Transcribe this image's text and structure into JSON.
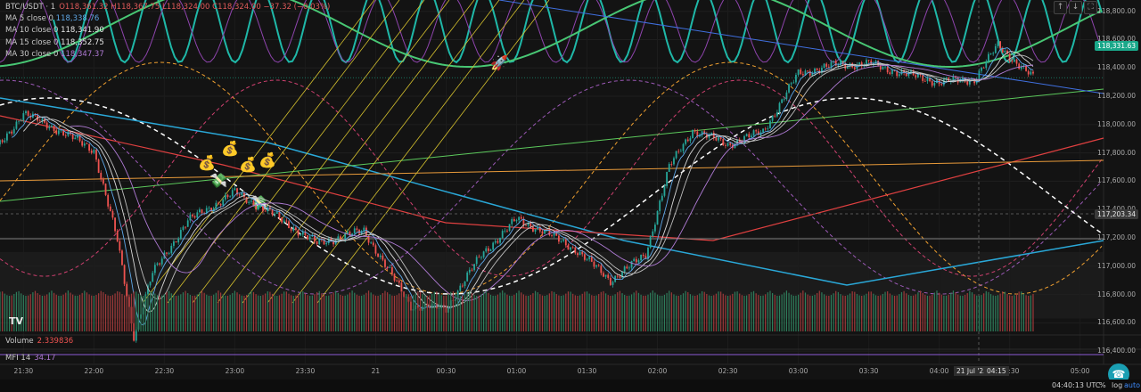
{
  "header": {
    "symbol": "BTC/USDT · 1",
    "ohlc": "O118,361.32 H118,367.75 L118,324.00 C118,324.00 −37.32 (−0.03%)"
  },
  "legend": [
    {
      "label": "MA 5 close 0",
      "value": "118,338.76",
      "color": "#5fa8e8"
    },
    {
      "label": "MA 10 close 0",
      "value": "118,341.90",
      "color": "#e8e8e8"
    },
    {
      "label": "MA 15 close 0",
      "value": "118,352.75",
      "color": "#e8e8e8"
    },
    {
      "label": "MA 30 close 0",
      "value": "118,347.37",
      "color": "#b07bd6"
    }
  ],
  "volume_pane": {
    "label": "Volume",
    "value": "2.339836"
  },
  "mfi_pane": {
    "label": "MFI 14",
    "value": "34.17"
  },
  "top_buttons": [
    "↑",
    "↓",
    "⛶"
  ],
  "y_axis": {
    "ticks": [
      "118,800.00",
      "118,600.00",
      "118,400.00",
      "118,200.00",
      "118,000.00",
      "117,800.00",
      "117,600.00",
      "117,400.00",
      "117,200.00",
      "117,000.00",
      "116,800.00",
      "116,600.00",
      "116,400.00"
    ],
    "current_price": "118,331.63",
    "crosshair_price": "117,203.34"
  },
  "x_axis": {
    "ticks": [
      "21:30",
      "22:00",
      "22:30",
      "23:00",
      "23:30",
      "21",
      "00:30",
      "01:00",
      "01:30",
      "02:00",
      "02:30",
      "03:00",
      "03:30",
      "04:00",
      "04:30",
      "05:00"
    ],
    "crosshair_label": "21 Jul '25",
    "crosshair_time": "04:15"
  },
  "status": {
    "clock": "04:40:13 UTC",
    "percent": "%",
    "log": "log",
    "auto": "auto"
  },
  "logo_text": "TV",
  "chart_data": {
    "type": "candlestick",
    "symbol": "BTC/USDT",
    "interval": "1",
    "ylim": [
      116300,
      118880
    ],
    "xrange": [
      "21:20",
      "05:10"
    ],
    "price_path": [
      [
        "21:20",
        117860
      ],
      [
        "21:30",
        118080
      ],
      [
        "21:45",
        117960
      ],
      [
        "22:00",
        117820
      ],
      [
        "22:10",
        117180
      ],
      [
        "22:17",
        116510
      ],
      [
        "22:25",
        116950
      ],
      [
        "22:40",
        117320
      ],
      [
        "22:50",
        117420
      ],
      [
        "23:00",
        117520
      ],
      [
        "23:15",
        117380
      ],
      [
        "23:35",
        117160
      ],
      [
        "23:55",
        117250
      ],
      [
        "00:15",
        116720
      ],
      [
        "00:30",
        116700
      ],
      [
        "00:45",
        117080
      ],
      [
        "01:00",
        117330
      ],
      [
        "01:10",
        117260
      ],
      [
        "01:25",
        117120
      ],
      [
        "01:40",
        116900
      ],
      [
        "01:55",
        117080
      ],
      [
        "02:05",
        117700
      ],
      [
        "02:15",
        117960
      ],
      [
        "02:30",
        117860
      ],
      [
        "02:45",
        117950
      ],
      [
        "03:00",
        118360
      ],
      [
        "03:15",
        118420
      ],
      [
        "03:30",
        118430
      ],
      [
        "03:45",
        118360
      ],
      [
        "04:00",
        118300
      ],
      [
        "04:15",
        118320
      ],
      [
        "04:25",
        118560
      ],
      [
        "04:40",
        118330
      ]
    ],
    "current_price": 118331.63,
    "crosshair": {
      "time": "04:15",
      "price": 117203.34
    },
    "volume_last": 2.339836,
    "mfi_last": 34.17
  }
}
